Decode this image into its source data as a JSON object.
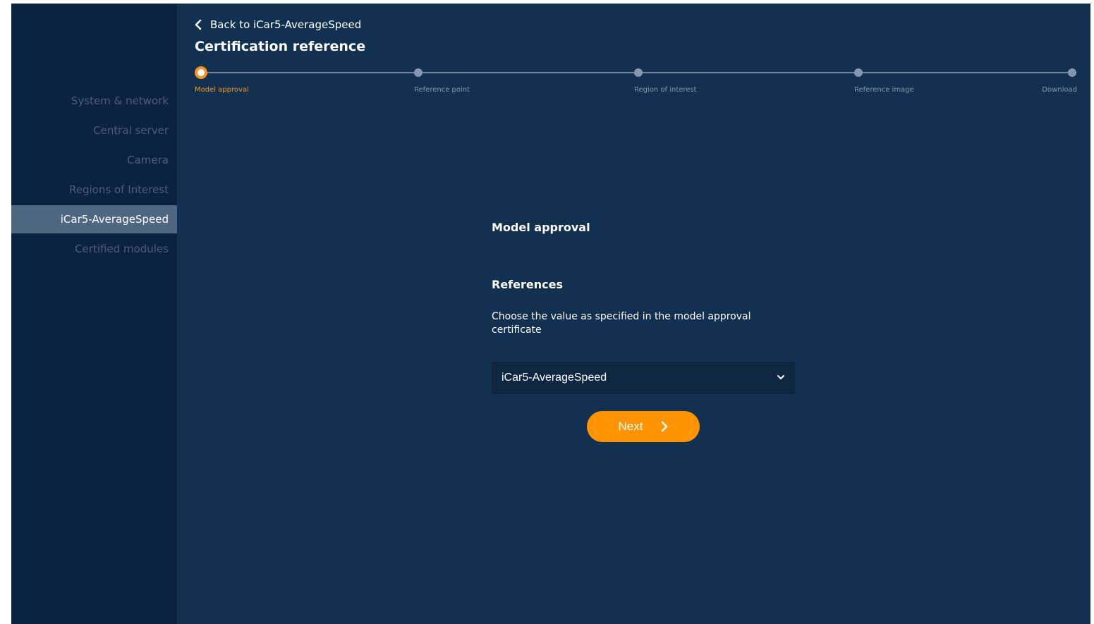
{
  "sidebar": {
    "items": [
      {
        "label": "System & network"
      },
      {
        "label": "Central server"
      },
      {
        "label": "Camera"
      },
      {
        "label": "Regions of Interest"
      },
      {
        "label": "iCar5-AverageSpeed",
        "active": true
      },
      {
        "label": "Certified modules"
      }
    ]
  },
  "header": {
    "back_label": "Back to iCar5-AverageSpeed",
    "title": "Certification reference"
  },
  "stepper": {
    "steps": [
      {
        "label": "Model approval",
        "active": true
      },
      {
        "label": "Reference point"
      },
      {
        "label": "Region of interest"
      },
      {
        "label": "Reference image"
      },
      {
        "label": "Download"
      }
    ]
  },
  "main": {
    "section_title": "Model approval",
    "subsection_title": "References",
    "description": "Choose the value as specified in the model approval certificate",
    "select_value": "iCar5-AverageSpeed",
    "next_label": "Next"
  },
  "colors": {
    "accent": "#ff9300",
    "background": "#12304f",
    "sidebar": "#0b2240"
  }
}
